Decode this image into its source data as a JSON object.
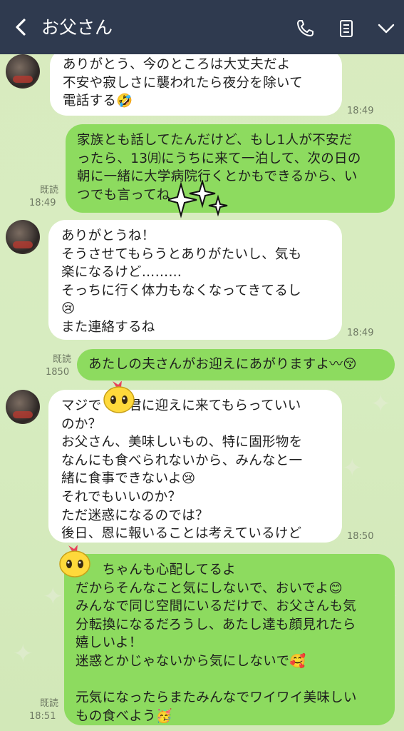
{
  "header": {
    "title": "お父さん",
    "icons": [
      "back-chevron-icon",
      "phone-icon",
      "memo-icon",
      "chevron-down-icon"
    ],
    "bg_color": "#2f3a4f"
  },
  "colors": {
    "outgoing_bubble": "#8ddb5f",
    "incoming_bubble": "#ffffff",
    "chat_bg": "#d7ecc0"
  },
  "messages": [
    {
      "id": "m1",
      "direction": "in",
      "text": "ありがとう、今のところは大丈夫だよ\n不安や寂しさに襲われたら夜分を除いて\n電話する🤣",
      "time": "18:49"
    },
    {
      "id": "m2",
      "direction": "out",
      "text": "家族とも話してたんだけど、もし1人が不安だ\nったら、13㈪にうちに来て一泊して、次の日の\n朝に一緒に大学病院行くとかもできるから、い\nつでも言ってね",
      "read": "既読",
      "time": "18:49"
    },
    {
      "id": "m3",
      "direction": "in",
      "text": "ありがとうね！\nそうさせてもらうとありがたいし、気も\n楽になるけど………\nそっちに行く体力もなくなってきてるし\n😢\nまた連絡するね",
      "time": "18:49"
    },
    {
      "id": "m4",
      "direction": "out",
      "text": "あたしの夫さんがお迎えにあがりますよ〰😚",
      "read": "既読",
      "time": "1850"
    },
    {
      "id": "m5",
      "direction": "in",
      "text": "マジで　　君に迎えに来てもらっていい\nのか？\nお父さん、美味しいもの、特に固形物を\nなんにも食べられないから、みんなと一\n緒に食事できないよ😢\nそれでもいいのか？\nただ迷惑になるのでは？\n後日、恩に報いることは考えているけど",
      "time": "18:50"
    },
    {
      "id": "m6",
      "direction": "out",
      "text": "　　ちゃんも心配してるよ\nだからそんなこと気にしないで、おいでよ😊\nみんなで同じ空間にいるだけで、お父さんも気\n分転換になるだろうし、あたし達も顔見れたら\n嬉しいよ！\n迷惑とかじゃないから気にしないで🥰\n\n元気になったらまたみんなでワイワイ美味しい\nもの食べよう🥳",
      "read": "既読",
      "time": "18:51"
    }
  ]
}
